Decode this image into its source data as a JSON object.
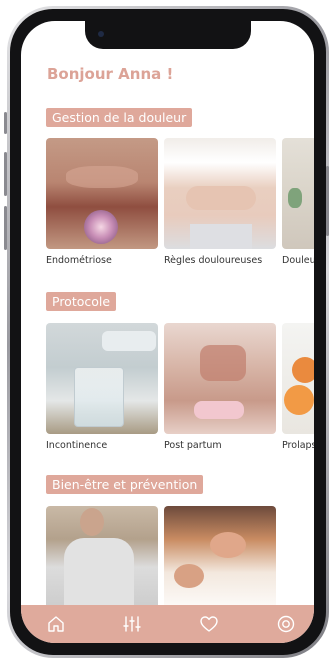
{
  "greeting": "Bonjour Anna !",
  "sections": [
    {
      "label": "Gestion de la douleur",
      "cards": [
        {
          "caption": "Endométriose"
        },
        {
          "caption": "Règles douloureuses"
        },
        {
          "caption": "Douleu"
        }
      ]
    },
    {
      "label": "Protocole",
      "cards": [
        {
          "caption": "Incontinence"
        },
        {
          "caption": "Post partum"
        },
        {
          "caption": "Prolaps"
        }
      ]
    },
    {
      "label": "Bien-être et prévention",
      "cards": [
        {
          "caption": ""
        },
        {
          "caption": ""
        }
      ]
    }
  ],
  "nav": {
    "items": [
      {
        "icon": "home-icon"
      },
      {
        "icon": "sliders-icon"
      },
      {
        "icon": "heart-icon"
      },
      {
        "icon": "profile-icon"
      }
    ],
    "background": "#dfaa9c"
  },
  "colors": {
    "accent": "#dfa89b",
    "greeting": "#dca397"
  }
}
